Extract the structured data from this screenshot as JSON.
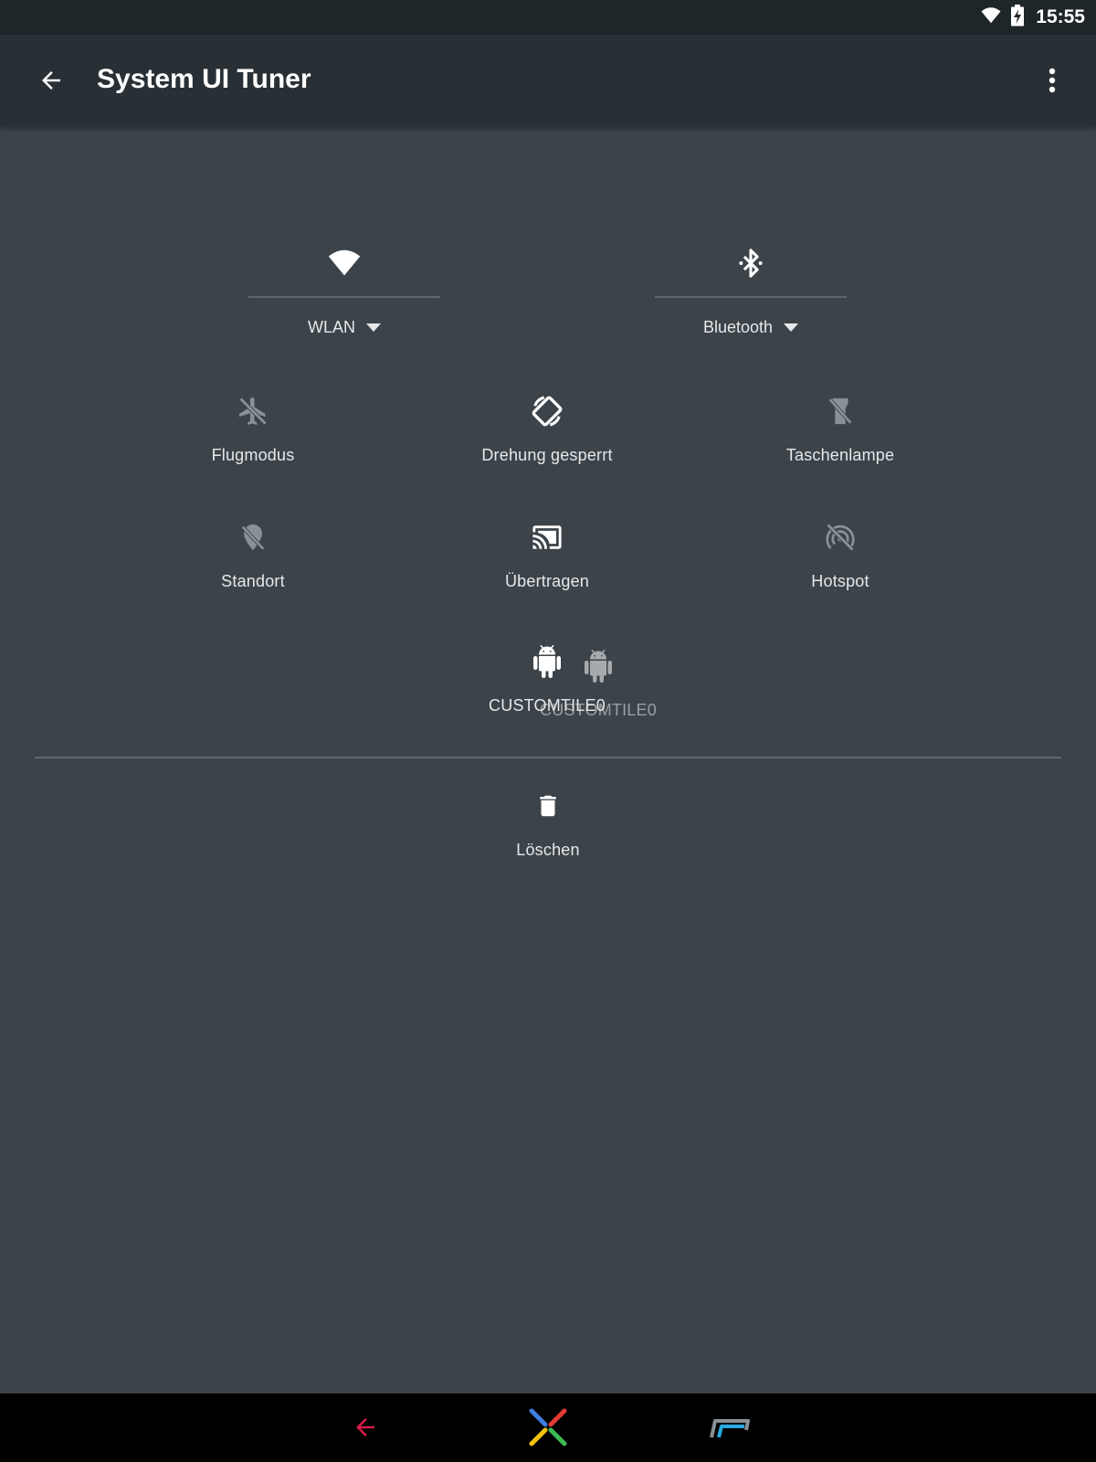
{
  "status_bar": {
    "time": "15:55",
    "icons": [
      "wifi-icon",
      "battery-charging-icon"
    ]
  },
  "toolbar": {
    "title": "System UI Tuner",
    "back_icon": "arrow-back-icon",
    "more_icon": "more-vert-icon"
  },
  "expanded_tiles": [
    {
      "label": "WLAN",
      "icon": "wifi-icon"
    },
    {
      "label": "Bluetooth",
      "icon": "bluetooth-icon"
    }
  ],
  "tiles": [
    {
      "label": "Flugmodus",
      "icon": "airplane-off-icon",
      "active": false
    },
    {
      "label": "Drehung gesperrt",
      "icon": "screen-rotation-icon",
      "active": true
    },
    {
      "label": "Taschenlampe",
      "icon": "flashlight-off-icon",
      "active": false
    },
    {
      "label": "Standort",
      "icon": "location-off-icon",
      "active": false
    },
    {
      "label": "Übertragen",
      "icon": "cast-icon",
      "active": true
    },
    {
      "label": "Hotspot",
      "icon": "hotspot-off-icon",
      "active": false
    },
    {
      "label": "CUSTOMTILE0",
      "icon": "android-icon",
      "active": true
    }
  ],
  "dragging_tile": {
    "label": "CUSTOMTILE0",
    "icon": "android-icon"
  },
  "delete_zone": {
    "label": "Löschen",
    "icon": "delete-icon"
  },
  "navigation": {
    "icons": [
      "nav-back-icon",
      "nav-home-icon",
      "nav-recents-icon"
    ]
  },
  "colors": {
    "background": "#3c444a",
    "toolbar": "#283035",
    "status_bar": "#1f2629",
    "divider": "#5f676c",
    "inactive_icon": "#8a9196",
    "nav_back": "#d81b4a",
    "nav_recents": "#29a9e0"
  }
}
